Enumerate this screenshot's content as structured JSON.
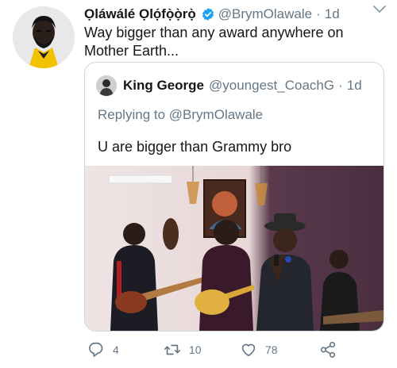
{
  "tweet": {
    "author_name": "Ọláwálé Ọlọ́fọ̀ọ̀rọ̀",
    "handle": "@BrymOlawale",
    "separator": "·",
    "time": "1d",
    "text": "Way bigger than any award anywhere on Mother Earth...",
    "verified_color": "#1da1f2"
  },
  "quoted": {
    "author_name": "King George",
    "handle": "@youngest_CoachG",
    "separator": "·",
    "time": "1d",
    "replying_prefix": "Replying to",
    "replying_to": "@BrymOlawale",
    "text": "U are bigger than Grammy bro"
  },
  "actions": {
    "replies": "4",
    "retweets": "10",
    "likes": "78"
  },
  "icons": [
    "avatar",
    "verified-badge-icon",
    "chevron-down-icon",
    "reply-icon",
    "retweet-icon",
    "like-icon",
    "share-icon"
  ]
}
